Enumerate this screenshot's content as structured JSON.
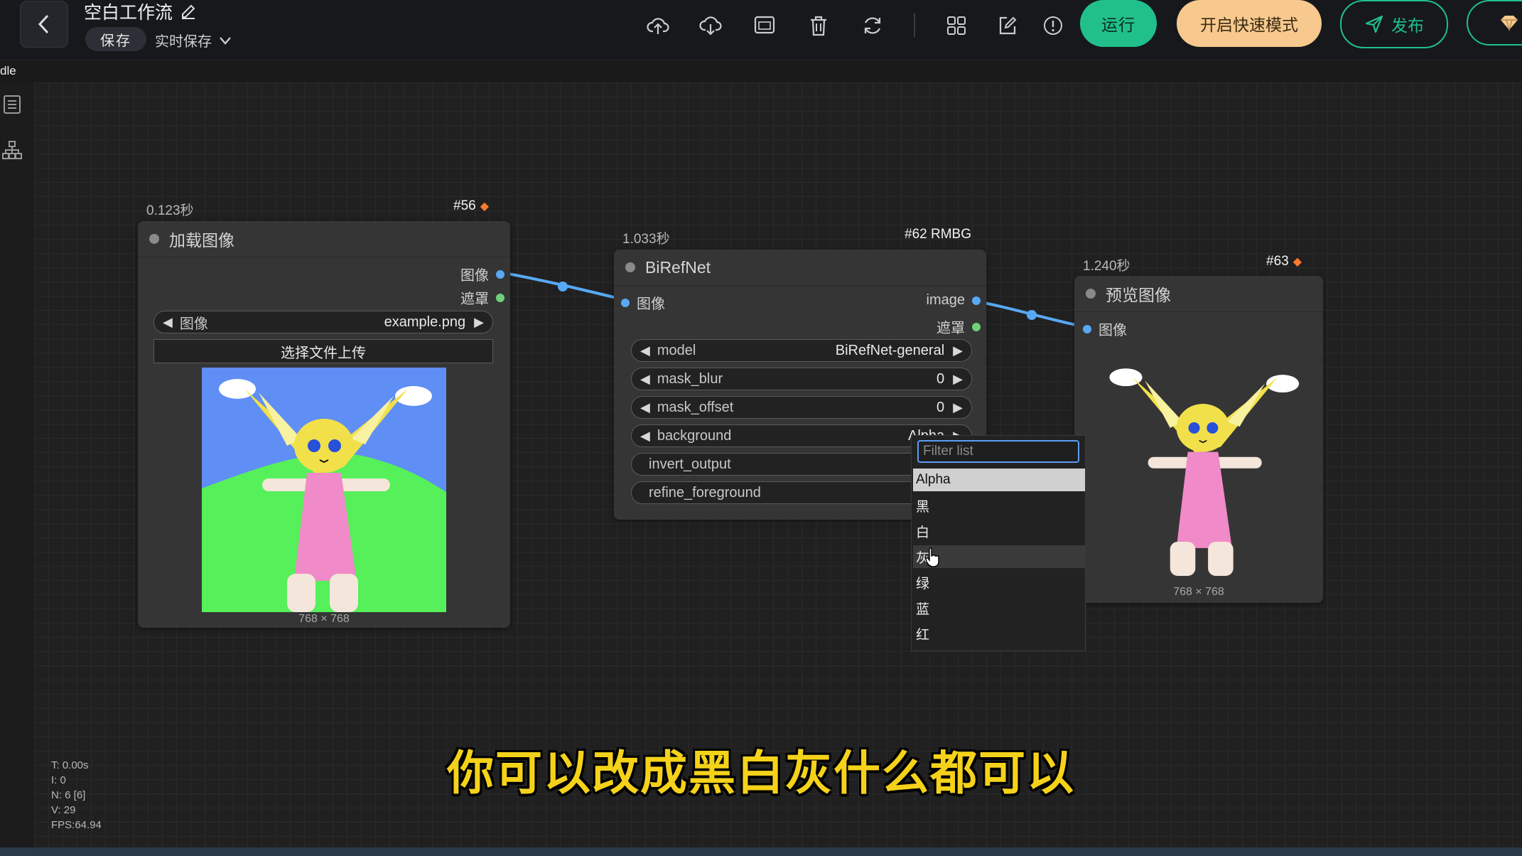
{
  "header": {
    "title": "空白工作流",
    "save_label": "保存",
    "autosave_label": "实时保存",
    "run_label": "运行",
    "fast_mode_label": "开启快速模式",
    "publish_label": "发布",
    "status": "dle"
  },
  "nodes": {
    "load_image": {
      "time": "0.123秒",
      "id": "#56",
      "title": "加载图像",
      "out_image": "图像",
      "out_mask": "遮罩",
      "widget_label": "图像",
      "widget_value": "example.png",
      "upload_label": "选择文件上传",
      "image_size": "768 × 768"
    },
    "birefnet": {
      "time": "1.033秒",
      "id": "#62 RMBG",
      "title": "BiRefNet",
      "in_image": "图像",
      "out_image": "image",
      "out_mask": "遮罩",
      "widgets": [
        {
          "label": "model",
          "value": "BiRefNet-general"
        },
        {
          "label": "mask_blur",
          "value": "0"
        },
        {
          "label": "mask_offset",
          "value": "0"
        },
        {
          "label": "background",
          "value": "Alpha"
        },
        {
          "label": "invert_output",
          "value": ""
        },
        {
          "label": "refine_foreground",
          "value": ""
        }
      ]
    },
    "preview": {
      "time": "1.240秒",
      "id": "#63",
      "title": "预览图像",
      "in_image": "图像",
      "image_size": "768 × 768"
    }
  },
  "dropdown": {
    "placeholder": "Filter list",
    "options": [
      "Alpha",
      "黑",
      "白",
      "灰",
      "绿",
      "蓝",
      "红"
    ],
    "selected": "Alpha"
  },
  "stats": {
    "t": "T: 0.00s",
    "i": "I: 0",
    "n": "N: 6 [6]",
    "v": "V: 29",
    "fps": "FPS:64.94"
  },
  "subtitle": "你可以改成黑白灰什么都可以",
  "colors": {
    "run": "#21c08b",
    "fast_mode": "#f7c98e",
    "link": "#58a9f5",
    "mask_pin": "#6fd07a",
    "subtitle": "#f5d21a"
  }
}
